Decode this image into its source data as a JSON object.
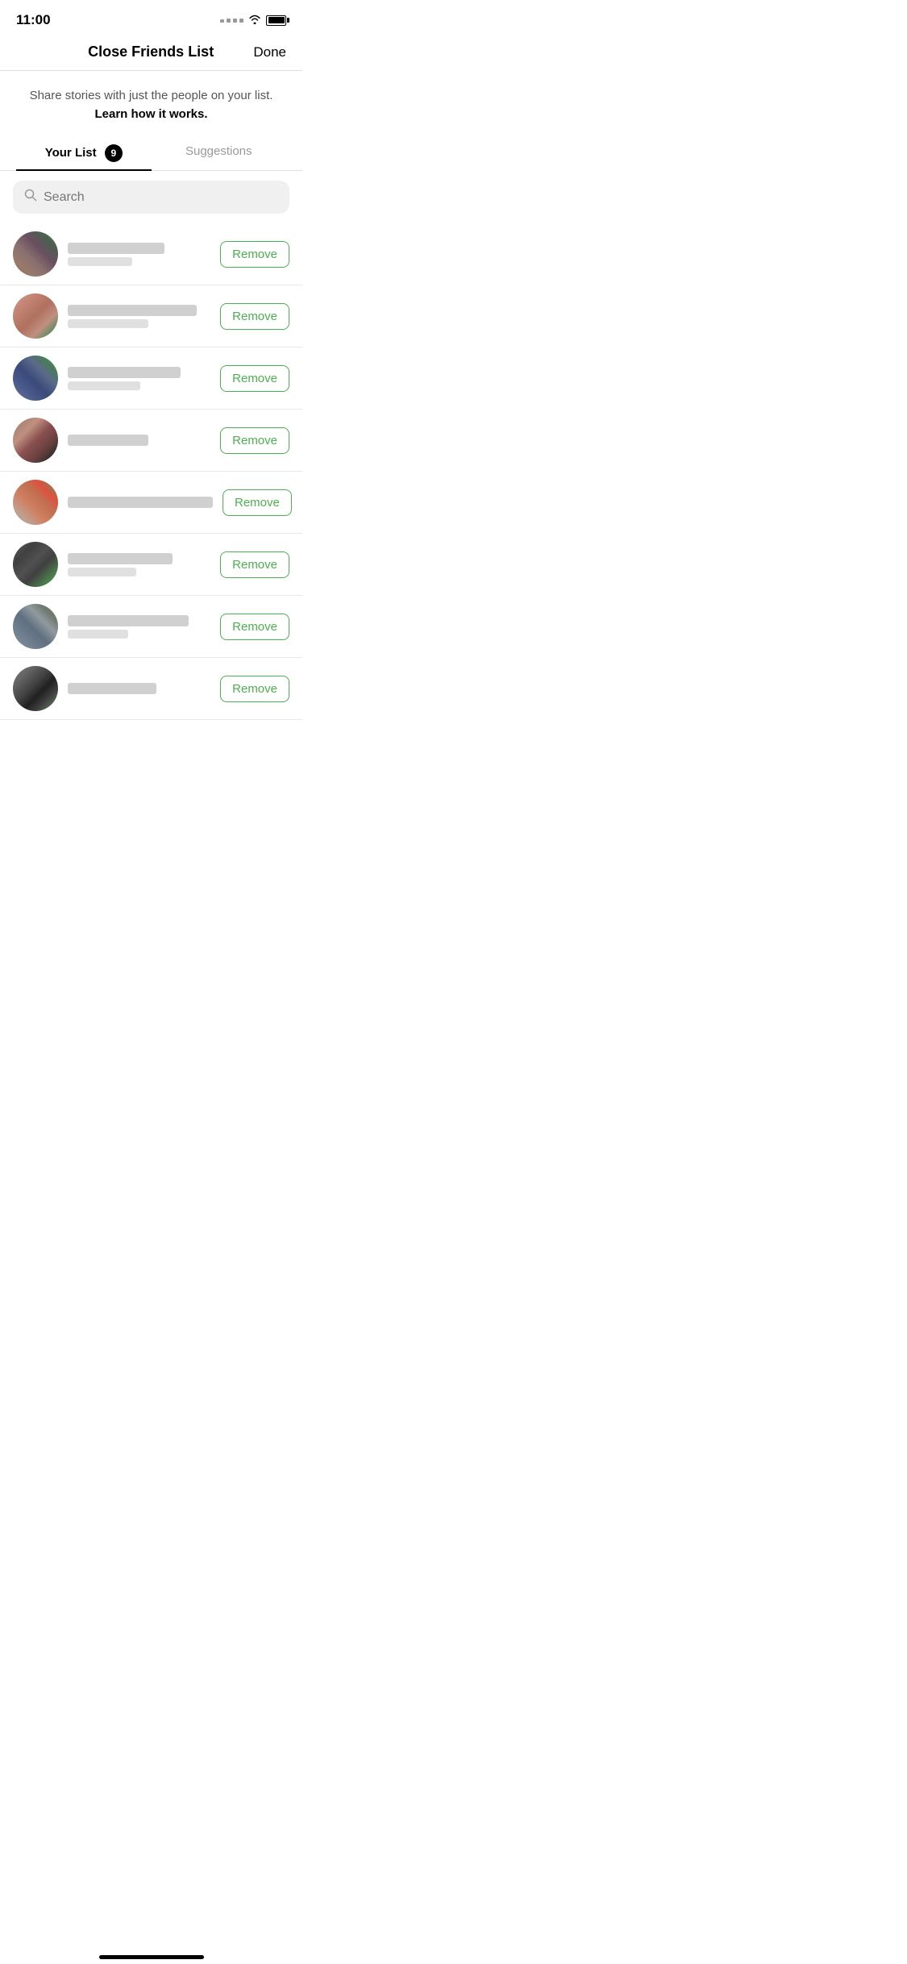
{
  "statusBar": {
    "time": "11:00",
    "battery": "full"
  },
  "header": {
    "title": "Close Friends List",
    "doneLabel": "Done"
  },
  "description": {
    "text": "Share stories with just the people on your list.",
    "linkText": "Learn how it works."
  },
  "tabs": [
    {
      "id": "your-list",
      "label": "Your List",
      "badge": "9",
      "active": true
    },
    {
      "id": "suggestions",
      "label": "Suggestions",
      "active": false
    }
  ],
  "search": {
    "placeholder": "Search"
  },
  "removeButtonLabel": "Remove",
  "friends": [
    {
      "id": 1,
      "avatarClass": "avatar-1",
      "usernameWidth": "120px",
      "fullnameWidth": "80px"
    },
    {
      "id": 2,
      "avatarClass": "avatar-2",
      "usernameWidth": "160px",
      "fullnameWidth": "100px"
    },
    {
      "id": 3,
      "avatarClass": "avatar-3",
      "usernameWidth": "140px",
      "fullnameWidth": "90px"
    },
    {
      "id": 4,
      "avatarClass": "avatar-4",
      "usernameWidth": "100px",
      "fullnameWidth": "60px"
    },
    {
      "id": 5,
      "avatarClass": "avatar-5",
      "usernameWidth": "180px",
      "fullnameWidth": "0px"
    },
    {
      "id": 6,
      "avatarClass": "avatar-6",
      "usernameWidth": "130px",
      "fullnameWidth": "85px"
    },
    {
      "id": 7,
      "avatarClass": "avatar-7",
      "usernameWidth": "150px",
      "fullnameWidth": "75px"
    },
    {
      "id": 8,
      "avatarClass": "avatar-8",
      "usernameWidth": "110px",
      "fullnameWidth": "0px"
    }
  ]
}
